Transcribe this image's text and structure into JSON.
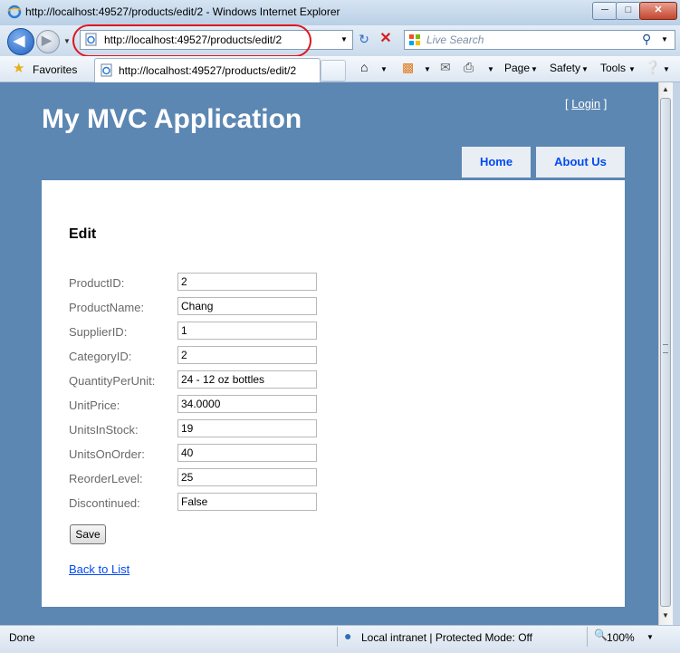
{
  "window": {
    "title": "http://localhost:49527/products/edit/2 - Windows Internet Explorer",
    "min_glyph": "─",
    "max_glyph": "□",
    "close_glyph": "✕"
  },
  "navbar": {
    "address": "http://localhost:49527/products/edit/2",
    "search_placeholder": "Live Search"
  },
  "favbar": {
    "favorites_label": "Favorites",
    "tab_title": "http://localhost:49527/products/edit/2",
    "commands": [
      "Page",
      "Safety",
      "Tools"
    ]
  },
  "page": {
    "app_title": "My MVC Application",
    "login_open": "[",
    "login_label": "Login",
    "login_close": "]",
    "menu": [
      "Home",
      "About Us"
    ],
    "heading": "Edit",
    "fields": [
      {
        "label": "ProductID:",
        "value": "2"
      },
      {
        "label": "ProductName:",
        "value": "Chang"
      },
      {
        "label": "SupplierID:",
        "value": "1"
      },
      {
        "label": "CategoryID:",
        "value": "2"
      },
      {
        "label": "QuantityPerUnit:",
        "value": "24 - 12 oz bottles"
      },
      {
        "label": "UnitPrice:",
        "value": "34.0000"
      },
      {
        "label": "UnitsInStock:",
        "value": "19"
      },
      {
        "label": "UnitsOnOrder:",
        "value": "40"
      },
      {
        "label": "ReorderLevel:",
        "value": "25"
      },
      {
        "label": "Discontinued:",
        "value": "False"
      }
    ],
    "save_label": "Save",
    "back_link": "Back to List"
  },
  "statusbar": {
    "status": "Done",
    "zone": "Local intranet | Protected Mode: Off",
    "zoom": "100%"
  },
  "colors": {
    "page_bg": "#5c87b2",
    "menu_text": "#034af3",
    "label_text": "#696969"
  }
}
